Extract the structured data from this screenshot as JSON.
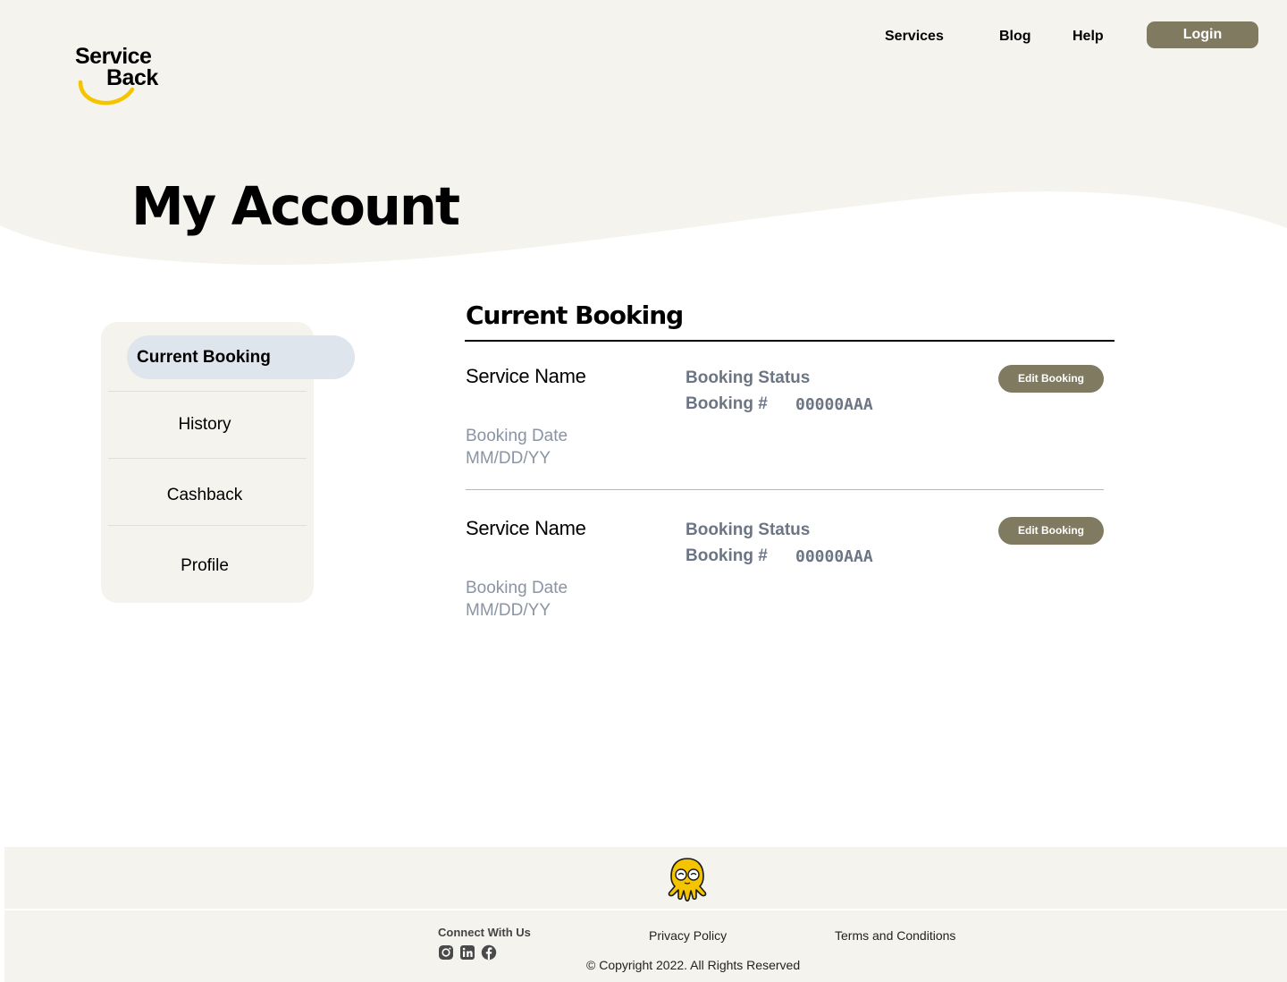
{
  "brand": {
    "logo_line1": "Service",
    "logo_line2": "Back",
    "accent": "#f5c400",
    "button_color": "#807a60",
    "hero_bg": "#f4f3ee"
  },
  "nav": {
    "items": [
      {
        "label": "Services"
      },
      {
        "label": "Blog"
      },
      {
        "label": "Help"
      }
    ],
    "login_label": "Login"
  },
  "page": {
    "title": "My Account"
  },
  "sidebar": {
    "items": [
      {
        "label": "Current Booking",
        "active": true
      },
      {
        "label": "History"
      },
      {
        "label": "Cashback"
      },
      {
        "label": "Profile"
      }
    ]
  },
  "main": {
    "section_title": "Current Booking",
    "bookings": [
      {
        "service_name": "Service Name",
        "status_label": "Booking Status",
        "number_label": "Booking #",
        "number": "00000AAA",
        "date_label": "Booking  Date",
        "date": "MM/DD/YY",
        "edit_label": "Edit Booking"
      },
      {
        "service_name": "Service Name",
        "status_label": "Booking Status",
        "number_label": "Booking #",
        "number": "00000AAA",
        "date_label": "Booking  Date",
        "date": "MM/DD/YY",
        "edit_label": "Edit Booking"
      }
    ]
  },
  "footer": {
    "connect_label": "Connect With Us",
    "social_icons": [
      "instagram-icon",
      "linkedin-icon",
      "facebook-icon"
    ],
    "privacy_label": "Privacy Policy",
    "terms_label": "Terms and Conditions",
    "copyright": "© Copyright 2022. All Rights Reserved"
  }
}
